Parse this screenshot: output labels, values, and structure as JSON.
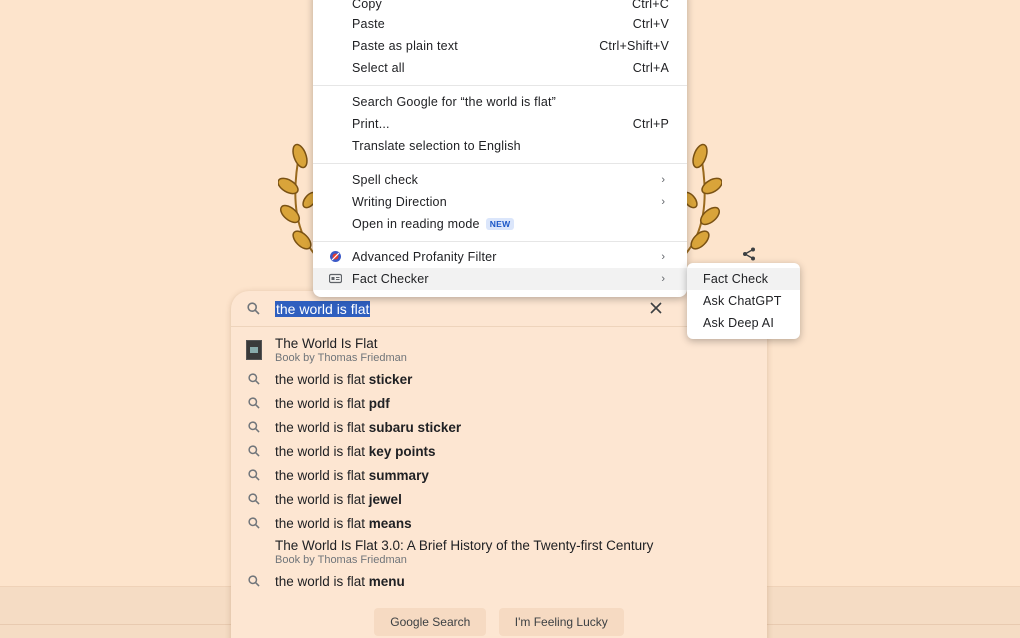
{
  "context_menu": {
    "items": [
      {
        "label": "Copy",
        "shortcut": "Ctrl+C"
      },
      {
        "label": "Paste",
        "shortcut": "Ctrl+V"
      },
      {
        "label": "Paste as plain text",
        "shortcut": "Ctrl+Shift+V"
      },
      {
        "label": "Select all",
        "shortcut": "Ctrl+A"
      },
      {
        "label": "Search Google for “the world is flat”",
        "shortcut": ""
      },
      {
        "label": "Print...",
        "shortcut": "Ctrl+P"
      },
      {
        "label": "Translate selection to English",
        "shortcut": ""
      },
      {
        "label": "Spell check",
        "shortcut": ""
      },
      {
        "label": "Writing Direction",
        "shortcut": ""
      },
      {
        "label": "Open in reading mode",
        "badge": "NEW"
      },
      {
        "label": "Advanced Profanity Filter",
        "shortcut": ""
      },
      {
        "label": "Fact Checker",
        "shortcut": ""
      }
    ]
  },
  "submenu": {
    "items": [
      {
        "label": "Fact Check"
      },
      {
        "label": "Ask ChatGPT"
      },
      {
        "label": "Ask Deep AI"
      }
    ]
  },
  "search": {
    "query": "the world is flat",
    "suggestions": [
      {
        "prefix": "The World Is Flat",
        "bold": "",
        "sub": "Book by Thomas Friedman"
      },
      {
        "prefix": "the world is flat ",
        "bold": "sticker"
      },
      {
        "prefix": "the world is flat ",
        "bold": "pdf"
      },
      {
        "prefix": "the world is flat ",
        "bold": "subaru sticker"
      },
      {
        "prefix": "the world is flat ",
        "bold": "key points"
      },
      {
        "prefix": "the world is flat ",
        "bold": "summary"
      },
      {
        "prefix": "the world is flat ",
        "bold": "jewel"
      },
      {
        "prefix": "the world is flat ",
        "bold": "means"
      },
      {
        "prefix": "The World Is Flat 3.0: A Brief History of the Twenty-first Century",
        "bold": "",
        "sub": "Book by Thomas Friedman"
      },
      {
        "prefix": "the world is flat ",
        "bold": "menu"
      }
    ],
    "google_search_label": "Google Search",
    "feeling_lucky_label": "I'm Feeling Lucky"
  },
  "colors": {
    "page_bg": "#fde4cc",
    "selection": "#2f5fbf",
    "laurel": "#d9a43a"
  }
}
